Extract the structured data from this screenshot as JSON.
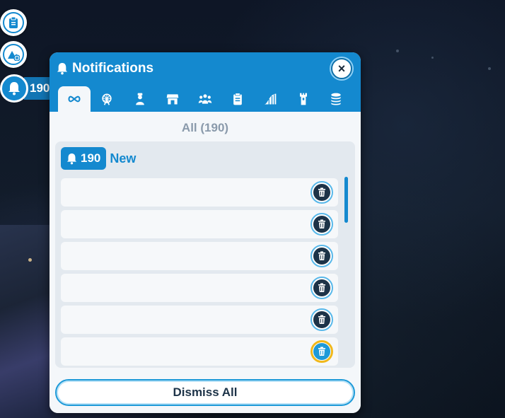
{
  "hud": {
    "notification_count": "190",
    "icons": [
      "clipboard-icon",
      "terrain-add-icon",
      "bell-icon"
    ]
  },
  "panel": {
    "title": "Notifications",
    "close_label": "×",
    "tabs": [
      {
        "icon": "infinity-icon",
        "active": true
      },
      {
        "icon": "ferris-wheel-icon",
        "active": false
      },
      {
        "icon": "staff-icon",
        "active": false
      },
      {
        "icon": "shop-icon",
        "active": false
      },
      {
        "icon": "guests-icon",
        "active": false
      },
      {
        "icon": "clipboard-icon",
        "active": false
      },
      {
        "icon": "coaster-icon",
        "active": false
      },
      {
        "icon": "tower-icon",
        "active": false
      },
      {
        "icon": "coins-icon",
        "active": false
      }
    ],
    "filter_label": "All (190)",
    "new_count": "190",
    "new_label": "New",
    "items": [
      {
        "text": ""
      },
      {
        "text": ""
      },
      {
        "text": ""
      },
      {
        "text": ""
      },
      {
        "text": ""
      },
      {
        "text": ""
      }
    ],
    "dismiss_all_label": "Dismiss All"
  },
  "colors": {
    "accent": "#1489cf",
    "dark": "#1d3348",
    "highlight": "#f0b81c"
  }
}
